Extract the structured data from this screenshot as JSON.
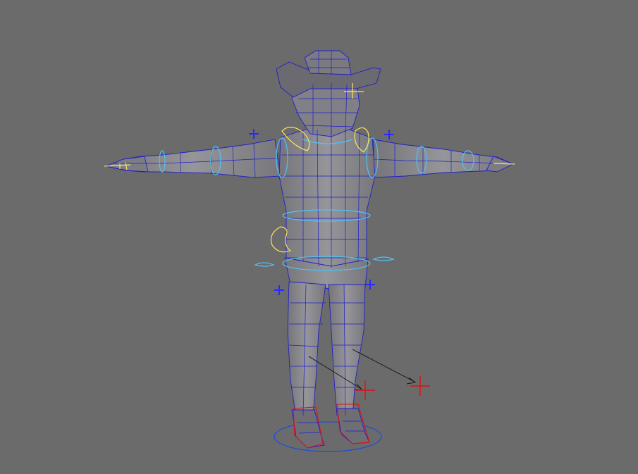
{
  "viewport": {
    "background": "#6b6b6b",
    "colors": {
      "mesh_fill": "#8a8a8e",
      "mesh_shade": "#737378",
      "wireframe": "#2020c8",
      "ik_control": "#4fc3f7",
      "fk_control": "#ffe45c",
      "locator": "#2828ff",
      "pole_vector": "#e01010",
      "foot_control": "#e01010",
      "root_control": "#1e4fd8"
    },
    "objects": [
      {
        "name": "character-mesh",
        "icon": "cowboy-character"
      },
      {
        "name": "root-control",
        "icon": "ellipse-ring"
      },
      {
        "name": "pole-vector-left",
        "icon": "red-cross"
      },
      {
        "name": "pole-vector-right",
        "icon": "red-cross"
      }
    ]
  }
}
